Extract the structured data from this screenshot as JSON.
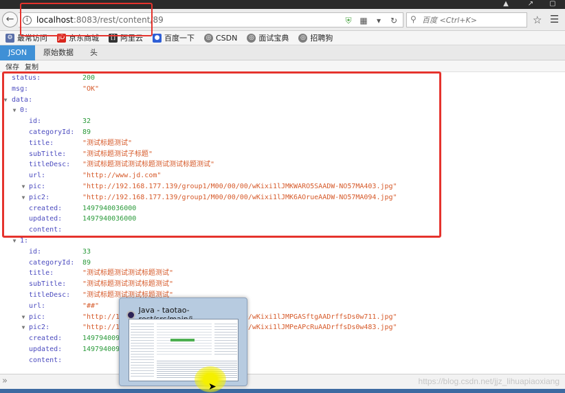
{
  "browser": {
    "url_host": "localhost",
    "url_path": ":8083/rest/content/89",
    "search_placeholder": "百度 <Ctrl+K>"
  },
  "bookmarks": [
    {
      "label": "最常访问",
      "icon": "gear-icon"
    },
    {
      "label": "京东商城",
      "icon": "jd-icon"
    },
    {
      "label": "阿里云",
      "icon": "aliyun-icon"
    },
    {
      "label": "百度一下",
      "icon": "baidu-icon"
    },
    {
      "label": "CSDN",
      "icon": "globe-icon"
    },
    {
      "label": "面试宝典",
      "icon": "globe-icon"
    },
    {
      "label": "招聘狗",
      "icon": "globe-icon"
    }
  ],
  "viewer": {
    "tabs": [
      "JSON",
      "原始数据",
      "头"
    ],
    "actions": [
      "保存",
      "复制"
    ]
  },
  "json": {
    "status": {
      "key": "status:",
      "value": "200"
    },
    "msg": {
      "key": "msg:",
      "value": "\"OK\""
    },
    "data_key": "data:",
    "items": [
      {
        "index": "0:",
        "fields": [
          {
            "key": "id:",
            "value": "32",
            "type": "num"
          },
          {
            "key": "categoryId:",
            "value": "89",
            "type": "num"
          },
          {
            "key": "title:",
            "value": "\"测试标题测试\"",
            "type": "str"
          },
          {
            "key": "subTitle:",
            "value": "\"测试标题测试子标题\"",
            "type": "str"
          },
          {
            "key": "titleDesc:",
            "value": "\"测试标题测试测试标题测试测试标题测试\"",
            "type": "str"
          },
          {
            "key": "url:",
            "value": "\"http://www.jd.com\"",
            "type": "str"
          },
          {
            "key": "pic:",
            "value": "\"http://192.168.177.139/group1/M00/00/00/wKixi1lJMKWARO5SAADW-NO57MA403.jpg\"",
            "type": "str"
          },
          {
            "key": "pic2:",
            "value": "\"http://192.168.177.139/group1/M00/00/00/wKixi1lJMK6AOrueAADW-NO57MA094.jpg\"",
            "type": "str"
          },
          {
            "key": "created:",
            "value": "1497940036000",
            "type": "num"
          },
          {
            "key": "updated:",
            "value": "1497940036000",
            "type": "num"
          },
          {
            "key": "content:",
            "value": "",
            "type": "str"
          }
        ]
      },
      {
        "index": "1:",
        "fields": [
          {
            "key": "id:",
            "value": "33",
            "type": "num"
          },
          {
            "key": "categoryId:",
            "value": "89",
            "type": "num"
          },
          {
            "key": "title:",
            "value": "\"测试标题测试测试标题测试\"",
            "type": "str"
          },
          {
            "key": "subTitle:",
            "value": "\"测试标题测试测试标题测试\"",
            "type": "str"
          },
          {
            "key": "titleDesc:",
            "value": "\"测试标题测试测试标题测试\"",
            "type": "str"
          },
          {
            "key": "url:",
            "value": "\"##\"",
            "type": "str"
          },
          {
            "key": "pic:",
            "value": "\"http://192.168.177.139/group1/M00/00/00/wKixi1lJMPGASftgAADrffsDs0w711.jpg\"",
            "type": "str"
          },
          {
            "key": "pic2:",
            "value": "\"http://192.168.177.139/group1/M00/00/00/wKixi1lJMPeAPcRuAADrffsDs0w483.jpg\"",
            "type": "str"
          },
          {
            "key": "created:",
            "value": "1497940092000",
            "type": "num"
          },
          {
            "key": "updated:",
            "value": "1497940092000",
            "type": "num"
          },
          {
            "key": "content:",
            "value": "",
            "type": "str"
          }
        ]
      }
    ]
  },
  "taskbar_preview": {
    "title": "Java - taotao-rest/src/main/j..."
  },
  "watermark": "https://blog.csdn.net/jjz_lihuapiaoxiang",
  "colors": {
    "key": "#4b4bbf",
    "number": "#2a9a3a",
    "string": "#d65a2a",
    "tab_active": "#3f90d6",
    "annotation": "#e5332d"
  }
}
